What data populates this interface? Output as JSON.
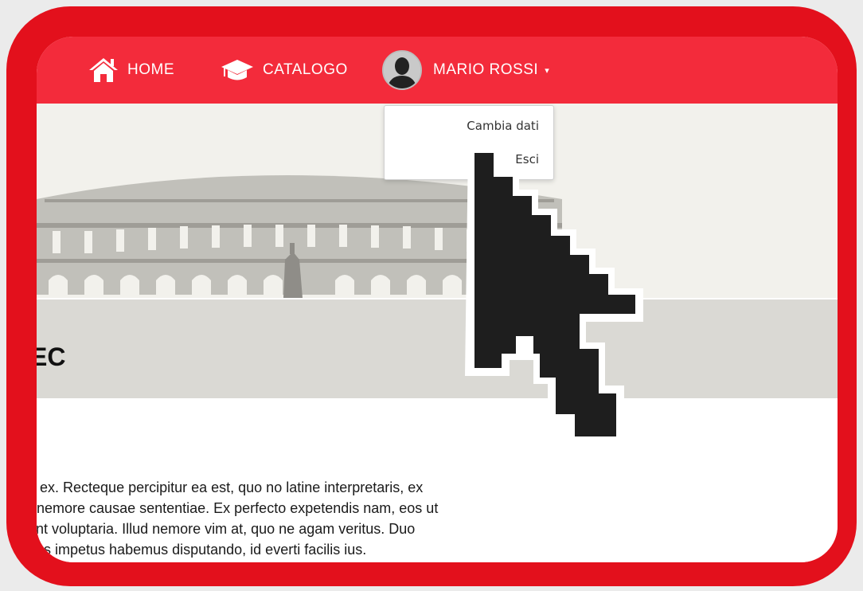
{
  "navbar": {
    "home_label": "HOME",
    "catalog_label": "CATALOGO",
    "user_label": "MARIO ROSSI",
    "caret": "▾"
  },
  "dropdown": {
    "items": [
      "Cambia dati",
      "Esci"
    ]
  },
  "page": {
    "title": "EC",
    "paragraph_lines": [
      "us ex. Recteque percipitur ea est, quo no latine interpretaris, ex",
      "at nemore causae sententiae. Ex perfecto expetendis nam, eos ut",
      "sunt voluptaria. Illud nemore vim at, quo ne agam veritus. Duo",
      "o ius impetus habemus disputando, id everti facilis ius."
    ]
  },
  "colors": {
    "frame": "#e3101c",
    "navbar": "#f32b3b",
    "hero": "#f2f1ec",
    "band": "#dad9d4",
    "cursor": "#1e1e1e"
  },
  "icons": [
    "home-icon",
    "graduation-cap-icon",
    "user-avatar-icon",
    "mouse-pointer-icon"
  ]
}
